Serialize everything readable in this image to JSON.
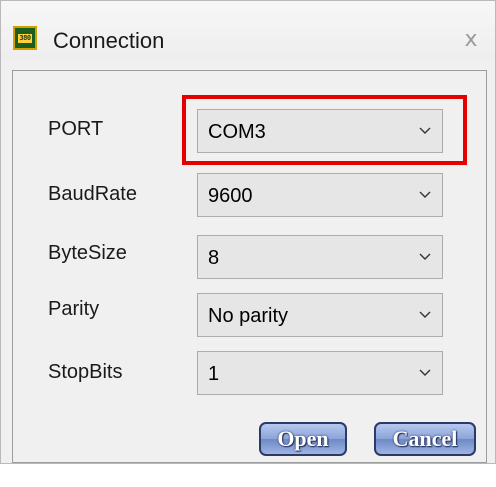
{
  "window": {
    "title": "Connection",
    "icon": "serial-device-icon",
    "icon_text": "380",
    "close_glyph": "x"
  },
  "form": {
    "port": {
      "label": "PORT",
      "value": "COM3"
    },
    "baudrate": {
      "label": "BaudRate",
      "value": "9600"
    },
    "bytesize": {
      "label": "ByteSize",
      "value": "8"
    },
    "parity": {
      "label": "Parity",
      "value": "No parity"
    },
    "stopbits": {
      "label": "StopBits",
      "value": "1"
    }
  },
  "buttons": {
    "open_label": "Open",
    "cancel_label": "Cancel"
  },
  "colors": {
    "highlight": "#e40000",
    "button_fill": "#8aa3d8",
    "button_border": "#2b3a66"
  }
}
